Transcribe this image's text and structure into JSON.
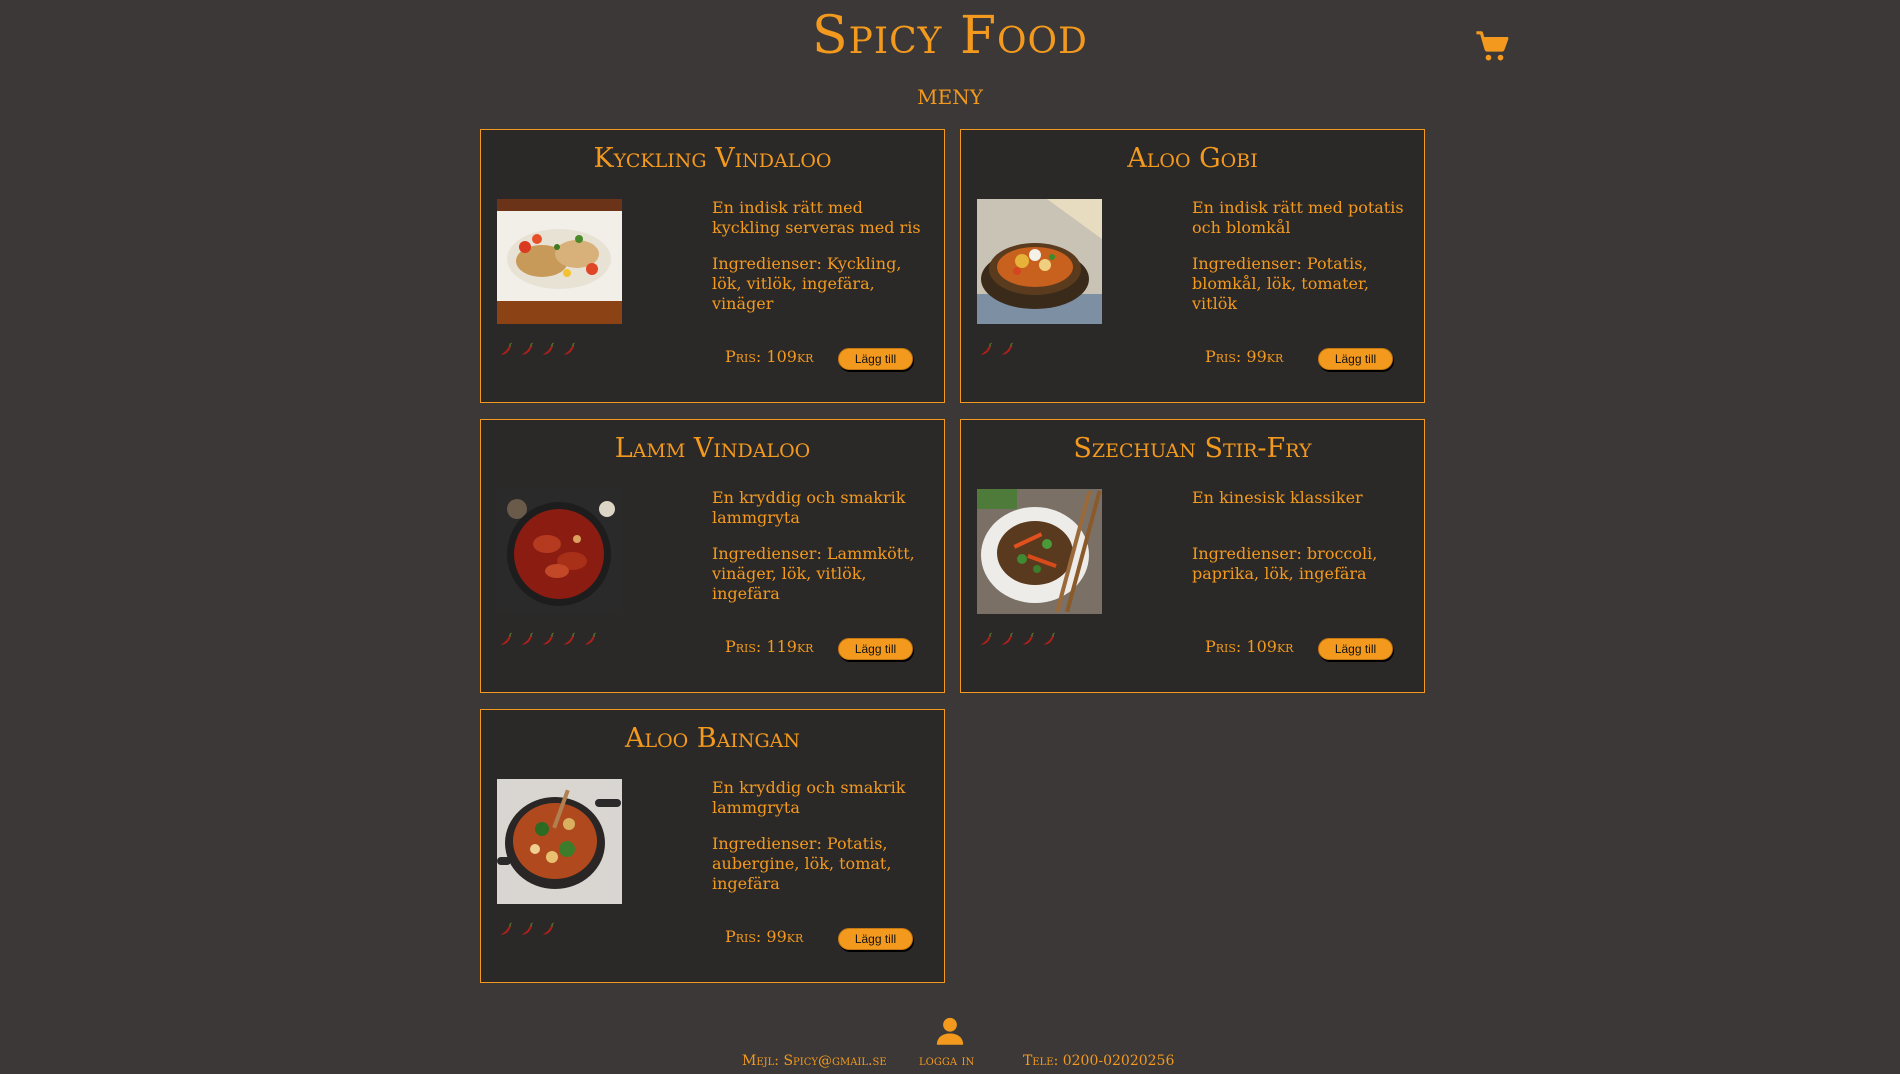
{
  "header": {
    "title": "Spicy Food",
    "menu_heading": "meny"
  },
  "icons": {
    "cart": "cart-icon",
    "user": "user-icon",
    "chili": "chili-icon"
  },
  "colors": {
    "accent": "#f39a1e",
    "background": "#3b3837",
    "card_background": "#2b2828",
    "chili": "#b0201a"
  },
  "dishes": [
    {
      "name": "Kyckling Vindaloo",
      "description": "En indisk rätt med kyckling serveras med ris",
      "ingredients": "Ingredienser: Kyckling, lök, vitlök, ingefära, vinäger",
      "spice_level": 4,
      "price": "Pris: 109kr",
      "button": "Lägg till"
    },
    {
      "name": "Aloo Gobi",
      "description": "En indisk rätt med potatis och blomkål",
      "ingredients": "Ingredienser: Potatis, blomkål, lök, tomater, vitlök",
      "spice_level": 2,
      "price": "Pris: 99kr",
      "button": "Lägg till"
    },
    {
      "name": "Lamm Vindaloo",
      "description": "En kryddig och smakrik lammgryta",
      "ingredients": "Ingredienser: Lammkött, vinäger, lök, vitlök, ingefära",
      "spice_level": 5,
      "price": "Pris: 119kr",
      "button": "Lägg till"
    },
    {
      "name": "Szechuan Stir-Fry",
      "description": "En kinesisk klassiker",
      "ingredients": "Ingredienser: broccoli, paprika, lök, ingefära",
      "spice_level": 4,
      "price": "Pris: 109kr",
      "button": "Lägg till"
    },
    {
      "name": "Aloo Baingan",
      "description": "En kryddig och smakrik lammgryta",
      "ingredients": "Ingredienser: Potatis, aubergine, lök, tomat, ingefära",
      "spice_level": 3,
      "price": "Pris: 99kr",
      "button": "Lägg till"
    }
  ],
  "footer": {
    "email": "Mejl: Spicy@gmail.se",
    "login": "logga in",
    "phone": "Tele: 0200-02020256"
  }
}
